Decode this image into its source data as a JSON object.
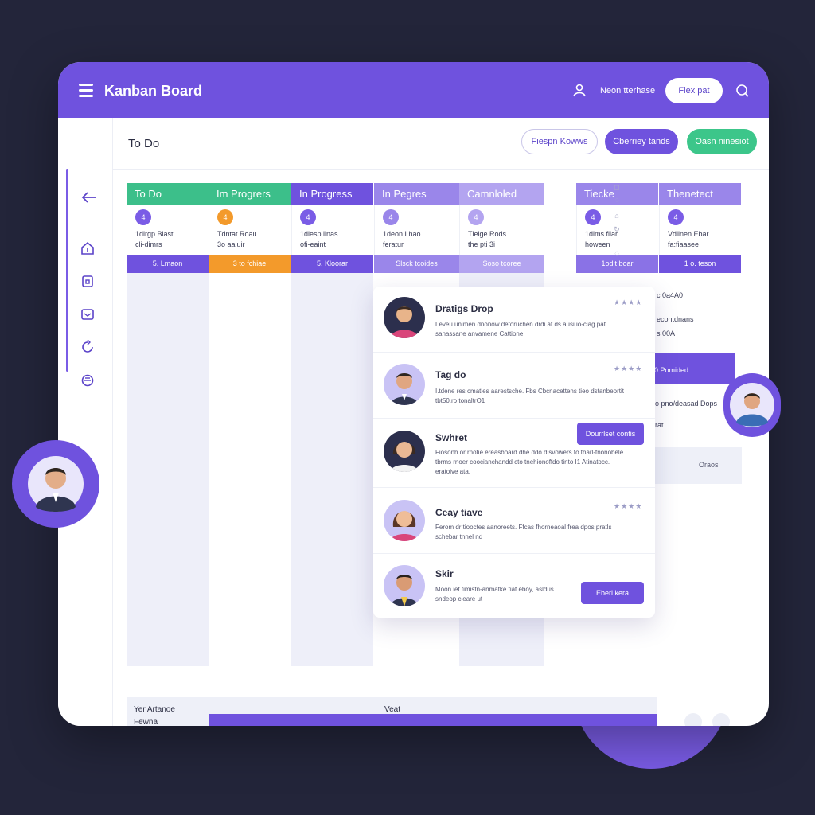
{
  "app": {
    "title": "Kanban Board",
    "user_name": "Neon tterhase",
    "top_button": "Flex pat"
  },
  "subheader": {
    "title": "To Do",
    "buttons": [
      "Fiespn Kowws",
      "Cberriey tands",
      "Oasn ninesiot"
    ]
  },
  "columns": [
    {
      "header": "To Do",
      "color": "#3cbf8a",
      "badge": "4",
      "badge_color": "#7a5ce6",
      "line1": "1dirgp Blast",
      "line2": "cli-dimrs",
      "footer": "5. Lmaon",
      "footer_color": "#6f52de"
    },
    {
      "header": "Im Progrers",
      "color": "#3cbf8a",
      "badge": "4",
      "badge_color": "#f39a2b",
      "line1": "Tdntat Roau",
      "line2": "3o aaiuir",
      "footer": "3 to fchiae",
      "footer_color": "#f39a2b"
    },
    {
      "header": "In Progress",
      "color": "#6f52de",
      "badge": "4",
      "badge_color": "#7a5ce6",
      "line1": "1dlesp linas",
      "line2": "ofi-eaint",
      "footer": "5. Kloorar",
      "footer_color": "#6f52de"
    },
    {
      "header": "In Pegres",
      "color": "#9a86ea",
      "badge": "4",
      "badge_color": "#9a86ea",
      "line1": "1deon Lhao",
      "line2": "feratur",
      "footer": "Slsck tcoides",
      "footer_color": "#9a86ea"
    },
    {
      "header": "Camnloled",
      "color": "#b3a4f0",
      "badge": "4",
      "badge_color": "#b3a4f0",
      "line1": "Tlelge Rods",
      "line2": "the pti 3i",
      "footer": "Soso tcoree",
      "footer_color": "#b3a4f0"
    },
    {
      "header": "Tiecke",
      "color": "#9a86ea",
      "badge": "4",
      "badge_color": "#7a5ce6",
      "line1": "1dims fliar",
      "line2": "hoween",
      "footer": "1odit boar",
      "footer_color": "#8a72e6"
    },
    {
      "header": "Thenetect",
      "color": "#9a86ea",
      "badge": "4",
      "badge_color": "#7a5ce6",
      "line1": "Vdiinen Ebar",
      "line2": "fa:fiaasee",
      "footer": "1 o. teson",
      "footer_color": "#6f52de"
    }
  ],
  "panel_items": [
    {
      "title": "Dratigs Drop",
      "line1": "Leveu unimen dnonow detoruchen drdi at ds ausi io-ciag pat.",
      "line2": "sanassane anvamene Cattione.",
      "stars": "★★★★"
    },
    {
      "title": "Tag do",
      "line1": "I.tdene res cmatles aarestsche. Fbs Cbcnacettens tieo dstanbeortit",
      "line2": "tbt50.ro tonaltrO1",
      "stars": "★★★★"
    },
    {
      "title": "Swhret",
      "line1": "Fiosonh or rnotie ereasboard dhe ddo dlsvowers to tharl-tnonobele",
      "line2": "tbrms rnoer coocianchandd cto tnehionoffdo tinto I1 Atinatocc.",
      "line3": "eratoive ata.",
      "button": "Dourrlset contis"
    },
    {
      "title": "Ceay tiave",
      "line1": "Ferom dr tiooctes aanoreets. Ffcas fhorneaoal frea dpos pratls",
      "line2": "schebar tnnel nd",
      "stars": "★★★★"
    },
    {
      "title": "Skir",
      "line1": "Moon iet timistn-anmatke fiat eboy, asldus",
      "line2": "sndeop cleare ut",
      "button": "Eberl kera"
    }
  ],
  "right_fragments": [
    "c 0a4A0",
    "econtdnans",
    "s 00A",
    "0 Pomided",
    "o pno/deasad Dops",
    "rat",
    "Oraos"
  ],
  "bottom": {
    "label1": "Yer Artanoe",
    "label2": "Fewna",
    "label3": "Veat"
  },
  "colors": {
    "accent": "#6f52de",
    "green": "#3cc68a",
    "orange": "#f39a2b",
    "background": "#23253a"
  },
  "icons": {
    "menu": "menu-icon",
    "user": "user-icon",
    "search": "search-icon",
    "back": "back-arrow-icon",
    "sidebar": [
      "home-icon",
      "box-icon",
      "inbox-icon",
      "refresh-icon",
      "settings-icon"
    ]
  }
}
